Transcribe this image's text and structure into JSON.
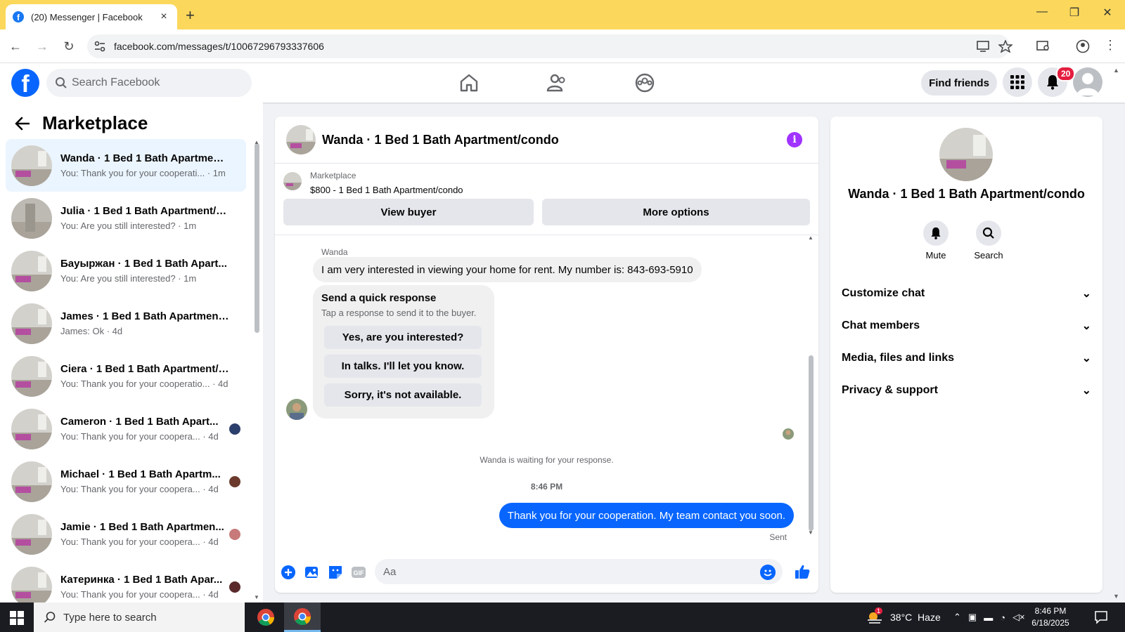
{
  "browser": {
    "tab_title": "(20) Messenger | Facebook",
    "url": "facebook.com/messages/t/10067296793337606"
  },
  "header": {
    "search_placeholder": "Search Facebook",
    "find_friends": "Find friends",
    "notification_count": "20"
  },
  "sidebar": {
    "title": "Marketplace",
    "conversations": [
      {
        "name": "Wanda · 1 Bed 1 Bath Apartment...",
        "snippet": "You: Thank you for your cooperati... · 1m",
        "active": true
      },
      {
        "name": "Julia · 1 Bed 1 Bath Apartment/c...",
        "snippet": "You: Are you still interested? · 1m"
      },
      {
        "name": "Бауыржан · 1 Bed 1 Bath Apart...",
        "snippet": "You: Are you still interested? · 1m"
      },
      {
        "name": "James · 1 Bed 1 Bath Apartment/...",
        "snippet": "James: Ok · 4d"
      },
      {
        "name": "Ciera · 1 Bed 1 Bath Apartment/c...",
        "snippet": "You: Thank you for your cooperatio... · 4d"
      },
      {
        "name": "Cameron · 1 Bed 1 Bath Apart...",
        "snippet": "You: Thank you for your coopera... · 4d"
      },
      {
        "name": "Michael · 1 Bed 1 Bath Apartm...",
        "snippet": "You: Thank you for your coopera... · 4d"
      },
      {
        "name": "Jamie · 1 Bed 1 Bath Apartmen...",
        "snippet": "You: Thank you for your coopera... · 4d"
      },
      {
        "name": "Катеринка · 1 Bed 1 Bath Apar...",
        "snippet": "You: Thank you for your coopera... · 4d"
      }
    ]
  },
  "chat": {
    "title": "Wanda · 1 Bed 1 Bath Apartment/condo",
    "marketplace_label": "Marketplace",
    "listing": "$800 - 1 Bed 1 Bath Apartment/condo",
    "view_buyer": "View buyer",
    "more_options": "More options",
    "sender": "Wanda",
    "incoming_message": "I am very interested in viewing your home for rent. My number is: 843-693-5910",
    "quick_title": "Send a quick response",
    "quick_subtitle": "Tap a response to send it to the buyer.",
    "quick_responses": [
      "Yes, are you interested?",
      "In talks. I'll let you know.",
      "Sorry, it's not available."
    ],
    "waiting": "Wanda is waiting for your response.",
    "timestamp": "8:46 PM",
    "outgoing_message": "Thank you for your cooperation. My team contact you soon.",
    "status": "Sent",
    "composer_placeholder": "Aa"
  },
  "details": {
    "title": "Wanda · 1 Bed 1 Bath Apartment/condo",
    "mute": "Mute",
    "search": "Search",
    "sections": [
      "Customize chat",
      "Chat members",
      "Media, files and links",
      "Privacy & support"
    ]
  },
  "taskbar": {
    "search_placeholder": "Type here to search",
    "weather": "38°C  Haze",
    "weather_badge": "1",
    "time": "8:46 PM",
    "date": "6/18/2025"
  },
  "colors": {
    "brand": "#0866ff",
    "chrome_tabstrip": "#fbd85c",
    "badge": "#e41e3f",
    "active_conversation": "#ebf5ff"
  }
}
